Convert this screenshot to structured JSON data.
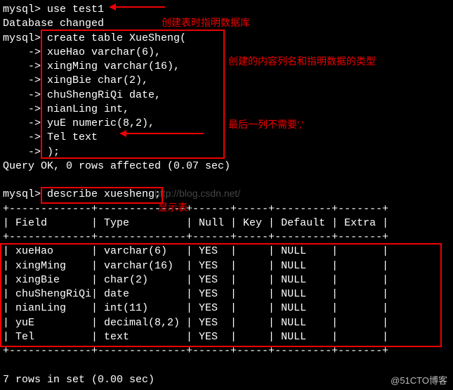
{
  "lines": {
    "l1": "mysql> use test1",
    "l2": "Database changed",
    "l3": "mysql> create table XueSheng(",
    "l4": "    -> xueHao varchar(6),",
    "l5": "    -> xingMing varchar(16),",
    "l6": "    -> xingBie char(2),",
    "l7": "    -> chuShengRiQi date,",
    "l8": "    -> nianLing int,",
    "l9": "    -> yuE numeric(8,2),",
    "l10": "    -> Tel text",
    "l11": "    -> );",
    "l12": "Query OK, 0 rows affected (0.07 sec)",
    "l13": "",
    "l14": "mysql> describe xuesheng;",
    "sep": "+-------------+--------------+------+-----+---------+-------+",
    "hdr": "| Field       | Type         | Null | Key | Default | Extra |",
    "r1": "| xueHao      | varchar(6)   | YES  |     | NULL    |       |",
    "r2": "| xingMing    | varchar(16)  | YES  |     | NULL    |       |",
    "r3": "| xingBie     | char(2)      | YES  |     | NULL    |       |",
    "r4": "| chuShengRiQi| date         | YES  |     | NULL    |       |",
    "r5": "| nianLing    | int(11)      | YES  |     | NULL    |       |",
    "r6": "| yuE         | decimal(8,2) | YES  |     | NULL    |       |",
    "r7": "| Tel         | text         | YES  |     | NULL    |       |",
    "l15": "",
    "l16": "7 rows in set (0.00 sec)"
  },
  "annotations": {
    "a1": "创建表时指明数据库",
    "a2": "创建的内容列名和指明数据的类型",
    "a3": "最后一列不需要','",
    "a4": "显示表"
  },
  "watermark": "http://blog.csdn.net/",
  "footer": "@51CTO博客",
  "chart_data": {
    "type": "table",
    "title": "describe xuesheng",
    "columns": [
      "Field",
      "Type",
      "Null",
      "Key",
      "Default",
      "Extra"
    ],
    "rows": [
      [
        "xueHao",
        "varchar(6)",
        "YES",
        "",
        "NULL",
        ""
      ],
      [
        "xingMing",
        "varchar(16)",
        "YES",
        "",
        "NULL",
        ""
      ],
      [
        "xingBie",
        "char(2)",
        "YES",
        "",
        "NULL",
        ""
      ],
      [
        "chuShengRiQi",
        "date",
        "YES",
        "",
        "NULL",
        ""
      ],
      [
        "nianLing",
        "int(11)",
        "YES",
        "",
        "NULL",
        ""
      ],
      [
        "yuE",
        "decimal(8,2)",
        "YES",
        "",
        "NULL",
        ""
      ],
      [
        "Tel",
        "text",
        "YES",
        "",
        "NULL",
        ""
      ]
    ]
  }
}
